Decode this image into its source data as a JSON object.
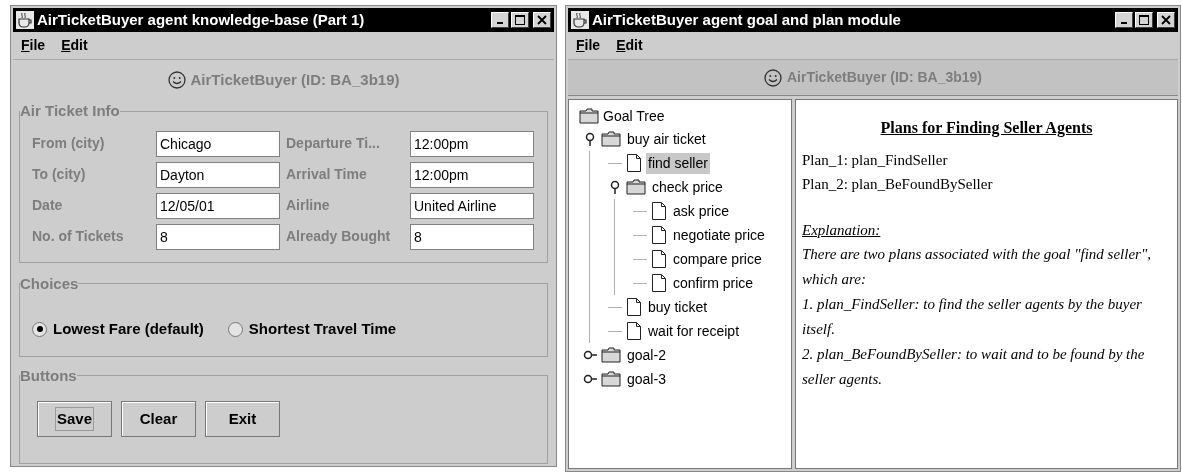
{
  "knowledge_base_window": {
    "title": "AirTicketBuyer agent knowledge-base (Part 1)",
    "menu": [
      "File",
      "Edit"
    ],
    "agent": "AirTicketBuyer (ID: BA_3b19)",
    "air_ticket_info": {
      "legend": "Air Ticket Info",
      "fields": [
        {
          "label": "From (city)",
          "value": "Chicago"
        },
        {
          "label": "Departure Ti...",
          "value": "12:00pm"
        },
        {
          "label": "To (city)",
          "value": "Dayton"
        },
        {
          "label": "Arrival Time",
          "value": "12:00pm"
        },
        {
          "label": "Date",
          "value": "12/05/01"
        },
        {
          "label": "Airline",
          "value": "United Airline"
        },
        {
          "label": "No. of Tickets",
          "value": "8"
        },
        {
          "label": "Already Bought",
          "value": "8"
        }
      ]
    },
    "choices": {
      "legend": "Choices",
      "options": [
        {
          "label": "Lowest Fare (default)",
          "selected": true
        },
        {
          "label": "Shortest Travel Time",
          "selected": false
        }
      ]
    },
    "buttons": {
      "legend": "Buttons",
      "items": [
        {
          "label": "Save",
          "focused": true
        },
        {
          "label": "Clear",
          "focused": false
        },
        {
          "label": "Exit",
          "focused": false
        }
      ]
    }
  },
  "goal_plan_window": {
    "title": "AirTicketBuyer agent goal and plan module",
    "menu": [
      "File",
      "Edit"
    ],
    "agent": "AirTicketBuyer (ID: BA_3b19)",
    "goal_tree": {
      "label": "Goal Tree",
      "children": [
        {
          "label": "buy air ticket",
          "kind": "folder",
          "expanded": true,
          "selected": false,
          "children": [
            {
              "label": "find seller",
              "kind": "leaf",
              "selected": true
            },
            {
              "label": "check price",
              "kind": "folder",
              "expanded": true,
              "selected": false,
              "children": [
                {
                  "label": "ask price",
                  "kind": "leaf",
                  "selected": false
                },
                {
                  "label": "negotiate price",
                  "kind": "leaf",
                  "selected": false
                },
                {
                  "label": "compare price",
                  "kind": "leaf",
                  "selected": false
                },
                {
                  "label": "confirm price",
                  "kind": "leaf",
                  "selected": false
                }
              ]
            },
            {
              "label": "buy ticket",
              "kind": "leaf",
              "selected": false
            },
            {
              "label": "wait for receipt",
              "kind": "leaf",
              "selected": false
            }
          ]
        },
        {
          "label": "goal-2",
          "kind": "folder",
          "expanded": false,
          "selected": false
        },
        {
          "label": "goal-3",
          "kind": "folder",
          "expanded": false,
          "selected": false
        }
      ]
    },
    "plan_view": {
      "heading": "Plans for Finding Seller Agents",
      "plans": [
        "Plan_1: plan_FindSeller",
        "Plan_2: plan_BeFoundBySeller"
      ],
      "explanation_heading": "Explanation:",
      "explanation": [
        "There are two plans associated with the goal \"find seller\", which are:",
        "1. plan_FindSeller: to find the seller agents by the buyer itself.",
        "2. plan_BeFoundBySeller: to wait and to be found by the seller agents."
      ]
    }
  }
}
